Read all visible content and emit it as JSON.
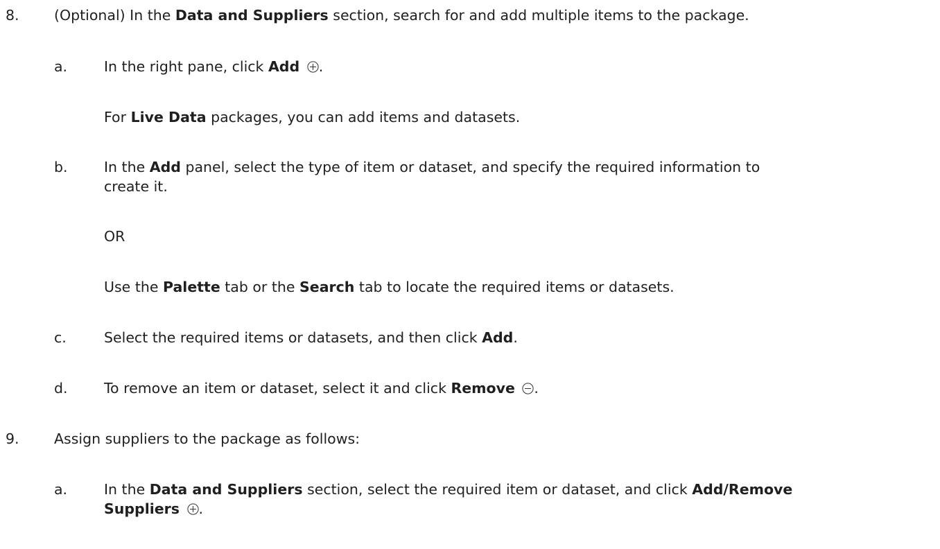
{
  "steps": [
    {
      "number": "8.",
      "parts": [
        {
          "t": "(Optional) In the "
        },
        {
          "t": "Data and Suppliers",
          "b": true
        },
        {
          "t": " section, search for and add multiple items to the package."
        }
      ],
      "substeps": [
        {
          "letter": "a.",
          "parts": [
            {
              "t": "In the right pane, click "
            },
            {
              "t": "Add",
              "b": true
            },
            {
              "t": " "
            },
            {
              "icon": "add-circle-icon"
            },
            {
              "t": "."
            }
          ],
          "note_parts": [
            {
              "t": "For "
            },
            {
              "t": "Live Data",
              "b": true
            },
            {
              "t": " packages, you can add items and datasets."
            }
          ]
        },
        {
          "letter": "b.",
          "line1_parts": [
            {
              "t": "In the "
            },
            {
              "t": "Add",
              "b": true
            },
            {
              "t": " panel, select the type of item or dataset, and specify the required information to"
            }
          ],
          "line2": "create it.",
          "or": "OR",
          "alt_parts": [
            {
              "t": "Use the "
            },
            {
              "t": "Palette",
              "b": true
            },
            {
              "t": " tab or the "
            },
            {
              "t": "Search",
              "b": true
            },
            {
              "t": " tab to locate the required items or datasets."
            }
          ]
        },
        {
          "letter": "c.",
          "parts": [
            {
              "t": "Select the required items or datasets, and then click "
            },
            {
              "t": "Add",
              "b": true
            },
            {
              "t": "."
            }
          ]
        },
        {
          "letter": "d.",
          "parts": [
            {
              "t": "To remove an item or dataset, select it and click "
            },
            {
              "t": "Remove",
              "b": true
            },
            {
              "t": " "
            },
            {
              "icon": "remove-circle-icon"
            },
            {
              "t": "."
            }
          ]
        }
      ]
    },
    {
      "number": "9.",
      "text": "Assign suppliers to the package as follows:",
      "substeps": [
        {
          "letter": "a.",
          "line1_parts": [
            {
              "t": "In the "
            },
            {
              "t": "Data and Suppliers",
              "b": true
            },
            {
              "t": " section, select the required item or dataset, and click "
            },
            {
              "t": "Add/Remove",
              "b": true
            }
          ],
          "line2_parts": [
            {
              "t": "Suppliers",
              "b": true
            },
            {
              "t": " "
            },
            {
              "icon": "add-circle-icon"
            },
            {
              "t": "."
            }
          ]
        }
      ]
    }
  ]
}
